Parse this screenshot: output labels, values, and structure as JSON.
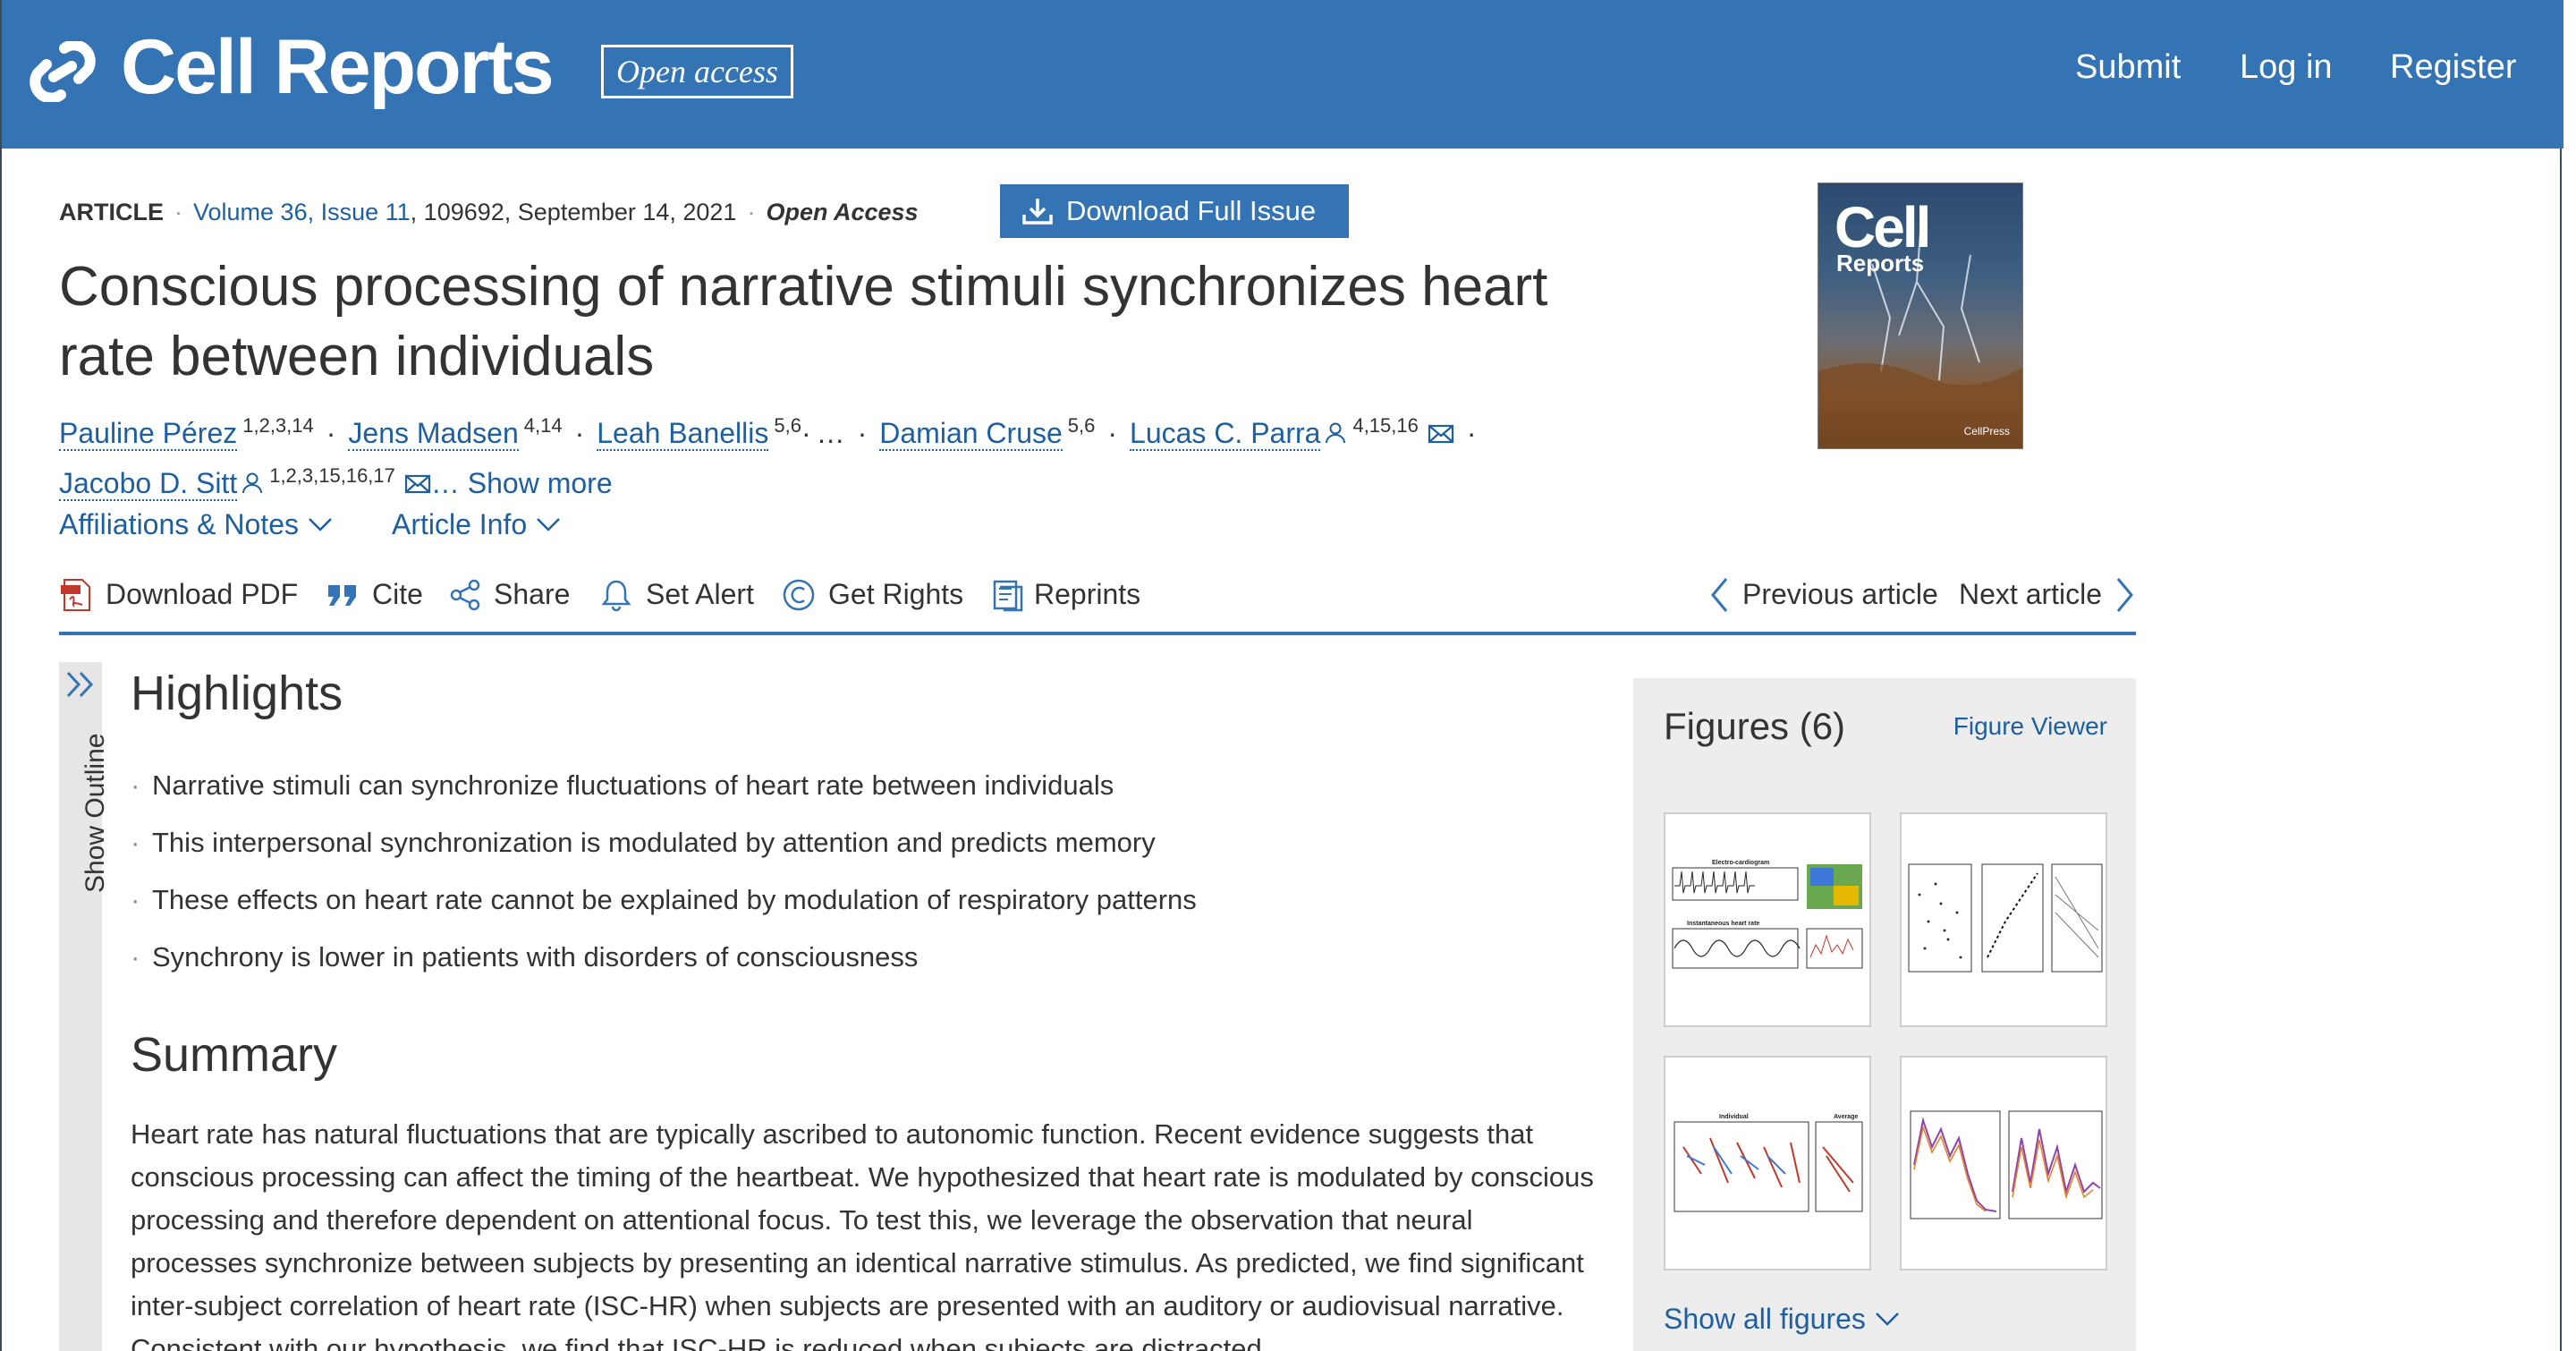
{
  "header": {
    "brand": "Cell Reports",
    "open_access_badge": "Open access",
    "nav": {
      "submit": "Submit",
      "login": "Log in",
      "register": "Register"
    }
  },
  "article_meta": {
    "type": "ARTICLE",
    "volume_issue": "Volume 36, Issue 11",
    "id_date": ", 109692, September 14, 2021",
    "open_access": "Open Access",
    "download_issue": "Download Full Issue"
  },
  "title": "Conscious processing of narrative stimuli synchronizes heart rate between individuals",
  "authors": [
    {
      "name": "Pauline Pérez",
      "sup": "1,2,3,14"
    },
    {
      "name": "Jens Madsen",
      "sup": "4,14"
    },
    {
      "name": "Leah Banellis",
      "sup": "5,6"
    },
    {
      "ellipsis": "…"
    },
    {
      "name": "Damian Cruse",
      "sup": "5,6"
    },
    {
      "name": "Lucas C. Parra",
      "sup": "4,15,16"
    },
    {
      "name": "Jacobo D. Sitt",
      "sup": "1,2,3,15,16,17"
    }
  ],
  "show_more": "… Show more",
  "cover": {
    "title": "Cell",
    "subtitle": "Reports",
    "publisher": "CellPress"
  },
  "dropdowns": {
    "affiliations": "Affiliations & Notes",
    "article_info": "Article Info"
  },
  "toolbar": {
    "download_pdf": "Download PDF",
    "cite": "Cite",
    "share": "Share",
    "set_alert": "Set Alert",
    "get_rights": "Get Rights",
    "reprints": "Reprints",
    "previous": "Previous article",
    "next": "Next article"
  },
  "outline_label": "Show Outline",
  "highlights": {
    "heading": "Highlights",
    "items": [
      "Narrative stimuli can synchronize fluctuations of heart rate between individuals",
      "This interpersonal synchronization is modulated by attention and predicts memory",
      "These effects on heart rate cannot be explained by modulation of respiratory patterns",
      "Synchrony is lower in patients with disorders of consciousness"
    ]
  },
  "summary": {
    "heading": "Summary",
    "text": "Heart rate has natural fluctuations that are typically ascribed to autonomic function. Recent evidence suggests that conscious processing can affect the timing of the heartbeat. We hypothesized that heart rate is modulated by conscious processing and therefore dependent on attentional focus. To test this, we leverage the observation that neural processes synchronize between subjects by presenting an identical narrative stimulus. As predicted, we find significant inter-subject correlation of heart rate (ISC-HR) when subjects are presented with an auditory or audiovisual narrative. Consistent with our hypothesis, we find that ISC-HR is reduced when subjects are distracted"
  },
  "figures": {
    "title": "Figures (6)",
    "viewer": "Figure Viewer",
    "show_all": "Show all figures",
    "thumb_labels": [
      "Electro-cardiogram",
      "Instantaneous heart rate",
      "Individual",
      "Average"
    ]
  },
  "colors": {
    "brand_blue": "#3474b4",
    "link_blue": "#1d5fa0",
    "text": "#333333",
    "panel_grey": "#ededed"
  }
}
